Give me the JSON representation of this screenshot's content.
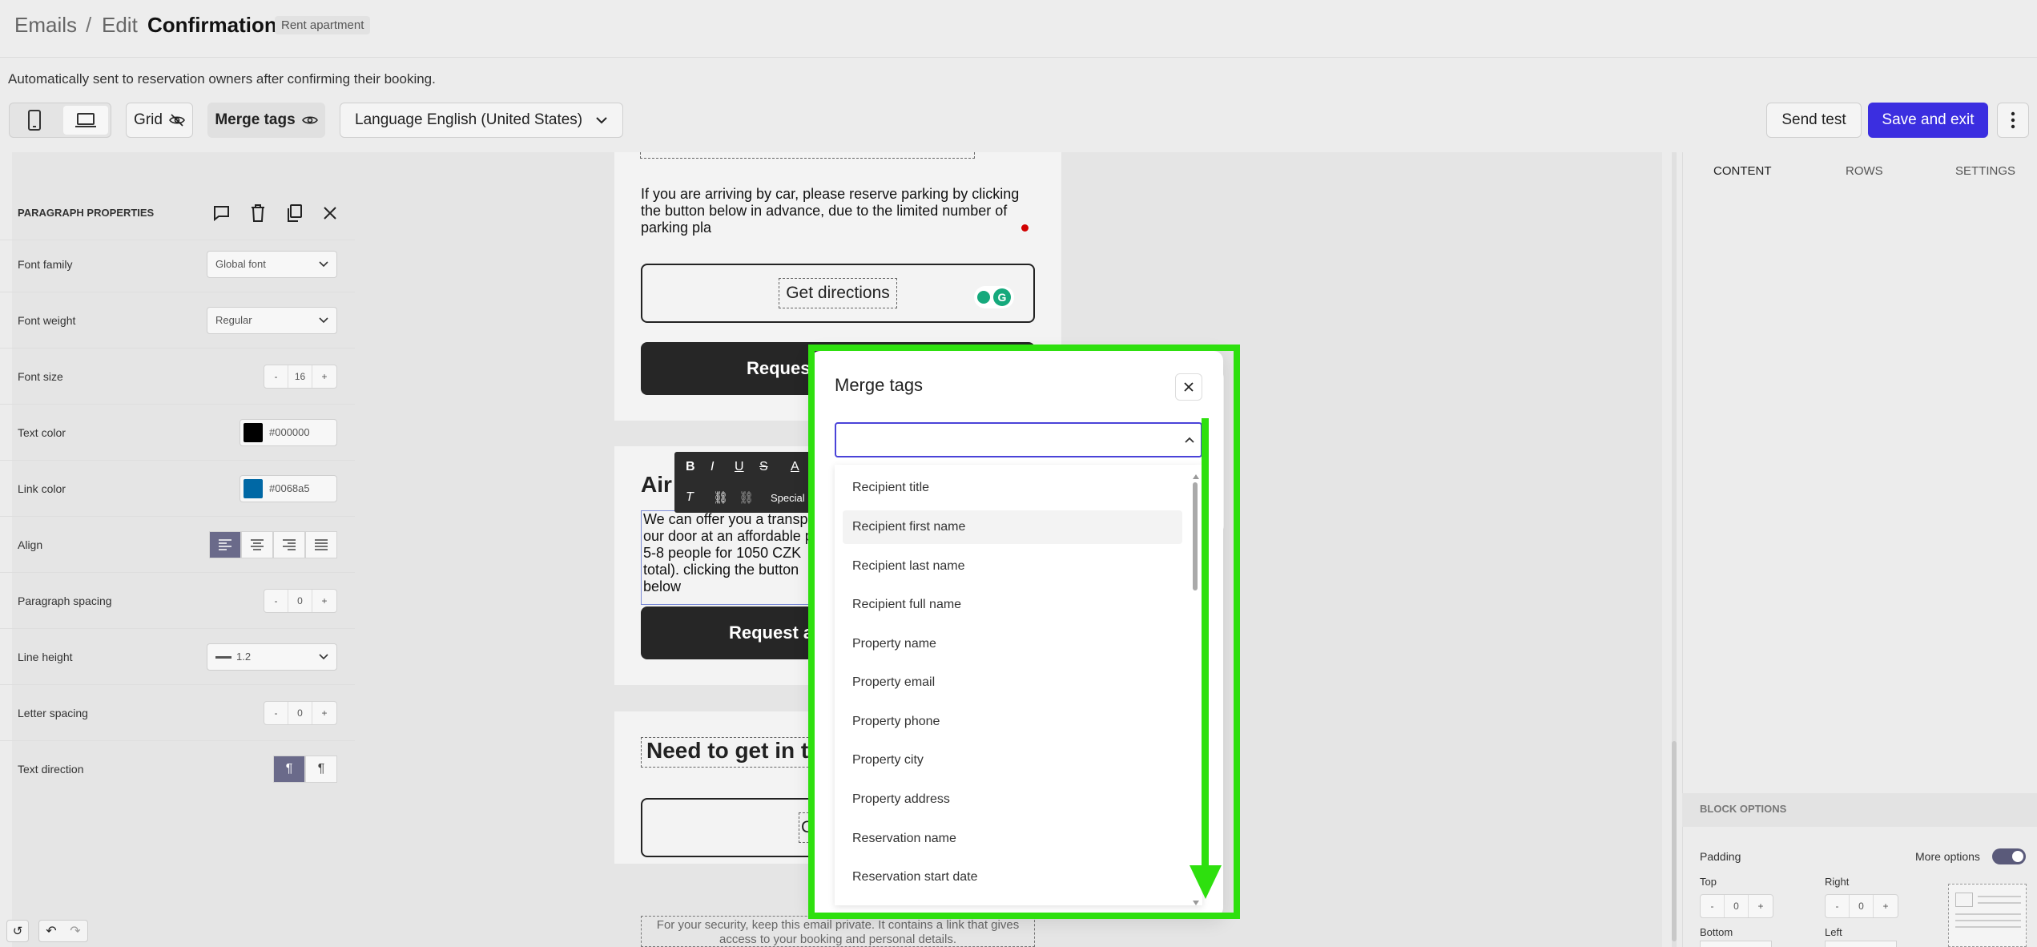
{
  "header": {
    "breadcrumb_root": "Emails",
    "separator": "/",
    "breadcrumb_action": "Edit",
    "title": "Confirmation",
    "badge": "Rent apartment",
    "description": "Automatically sent to reservation owners after confirming their booking."
  },
  "toolbar": {
    "mobile_icon": "phone-icon",
    "desktop_icon": "laptop-icon",
    "grid_label": "Grid",
    "merge_tags_label": "Merge tags",
    "language_label": "Language English (United States)",
    "send_test_label": "Send test",
    "save_exit_label": "Save and exit",
    "accent_color": "#3b2ee0"
  },
  "email": {
    "parking_text": "If you are arriving by car, please reserve parking by clicking the button below in advance, due to the limited number of parking pla",
    "get_directions_label": "Get directions",
    "request_parking_label": "Request",
    "airport_heading": "Air",
    "airport_text": "We can offer you a transpo our door at an affordable price 5-8 people for 1050 CZK total). clicking the button below",
    "request_airport_label": "Request an ai",
    "contact_heading": "Need to get in tou",
    "contact_label": "Conta",
    "footer_text": "For your security, keep this email private. It contains a link that gives access to your booking and personal details.",
    "format_special_label": "Special"
  },
  "merge_modal": {
    "title": "Merge tags",
    "search_value": "",
    "options": [
      "Recipient title",
      "Recipient first name",
      "Recipient last name",
      "Recipient full name",
      "Property name",
      "Property email",
      "Property phone",
      "Property city",
      "Property address",
      "Reservation name",
      "Reservation start date"
    ],
    "highlighted_option": "Recipient first name",
    "annotation_color": "#2ee00e"
  },
  "panel": {
    "tabs": [
      "CONTENT",
      "ROWS",
      "SETTINGS"
    ],
    "section_title": "PARAGRAPH PROPERTIES",
    "font_family_label": "Font family",
    "font_family_value": "Global font",
    "font_weight_label": "Font weight",
    "font_weight_value": "Regular",
    "font_size_label": "Font size",
    "font_size_value": "16",
    "text_color_label": "Text color",
    "text_color_value": "#000000",
    "link_color_label": "Link color",
    "link_color_value": "#0068a5",
    "align_label": "Align",
    "paragraph_spacing_label": "Paragraph spacing",
    "paragraph_spacing_value": "0",
    "line_height_label": "Line height",
    "line_height_value": "1.2",
    "letter_spacing_label": "Letter spacing",
    "letter_spacing_value": "0",
    "text_direction_label": "Text direction",
    "block_options_title": "BLOCK OPTIONS",
    "padding_label": "Padding",
    "more_options_label": "More options",
    "top_label": "Top",
    "top_value": "0",
    "right_label": "Right",
    "right_value": "0",
    "bottom_label": "Bottom",
    "left_label": "Left",
    "minus": "-",
    "plus": "+"
  }
}
